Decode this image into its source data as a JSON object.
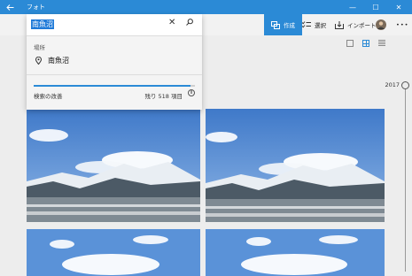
{
  "titlebar": {
    "title": "フォト",
    "back_icon": "back-arrow-icon",
    "minimize_glyph": "—",
    "maximize_glyph": "☐",
    "close_glyph": "✕",
    "color": "#2b8ad6"
  },
  "toolbar": {
    "create_label": "作成",
    "select_label": "選択",
    "import_label": "インポート",
    "more_glyph": "•••"
  },
  "search": {
    "query": "南魚沼",
    "section_label": "場所",
    "result": "南魚沼",
    "close_glyph": "✕",
    "go_glyph": "⌕"
  },
  "improve": {
    "label": "検索の改善",
    "remaining": "残り 518 項目",
    "progress": 0.97,
    "pause_glyph": "II"
  },
  "timeline": {
    "year": "2017"
  }
}
